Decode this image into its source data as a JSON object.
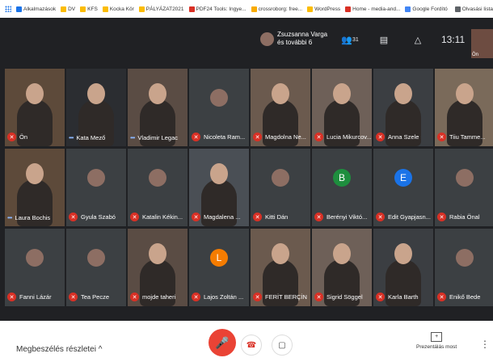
{
  "bookmarks": [
    "Alkalmazások",
    "DV",
    "KFS",
    "Kocka Kör",
    "PÁLYÁZAT2021",
    "PDF24 Tools: Ingye...",
    "crossroborg: free...",
    "WordPress",
    "Home - media-and...",
    "Google Fordító",
    "Olvasási lista"
  ],
  "meeting": {
    "owner_name": "Zsuzsanna Varga",
    "owner_more": "és további 6",
    "participants_count": "31",
    "clock": "13:11",
    "self_label": "Ön"
  },
  "participants": [
    {
      "name": "Ön",
      "muted": true,
      "avatar_letter": "",
      "avatar_color": "",
      "kind": "video"
    },
    {
      "name": "Kata Mező",
      "muted": false,
      "avatar_letter": "",
      "avatar_color": "",
      "kind": "video"
    },
    {
      "name": "Vladimir Legac",
      "muted": false,
      "avatar_letter": "",
      "avatar_color": "",
      "kind": "video"
    },
    {
      "name": "Nicoleta Ram...",
      "muted": true,
      "avatar_letter": "",
      "avatar_color": "",
      "kind": "photo"
    },
    {
      "name": "Magdolna Ne...",
      "muted": true,
      "avatar_letter": "",
      "avatar_color": "",
      "kind": "video"
    },
    {
      "name": "Lucia Mikurcov...",
      "muted": true,
      "avatar_letter": "",
      "avatar_color": "",
      "kind": "video"
    },
    {
      "name": "Anna Szele",
      "muted": true,
      "avatar_letter": "",
      "avatar_color": "",
      "kind": "video"
    },
    {
      "name": "Tiiu Tamme...",
      "muted": true,
      "avatar_letter": "",
      "avatar_color": "",
      "kind": "video"
    },
    {
      "name": "Laura Bochis",
      "muted": false,
      "avatar_letter": "",
      "avatar_color": "",
      "kind": "video"
    },
    {
      "name": "Gyula Szabó",
      "muted": true,
      "avatar_letter": "",
      "avatar_color": "",
      "kind": "photo"
    },
    {
      "name": "Katalin Kékin...",
      "muted": true,
      "avatar_letter": "",
      "avatar_color": "",
      "kind": "photo"
    },
    {
      "name": "Magdalena ...",
      "muted": true,
      "avatar_letter": "",
      "avatar_color": "",
      "kind": "video"
    },
    {
      "name": "Kitti Dán",
      "muted": true,
      "avatar_letter": "",
      "avatar_color": "",
      "kind": "photo"
    },
    {
      "name": "Berényi Viktó...",
      "muted": true,
      "avatar_letter": "B",
      "avatar_color": "#1e8e3e",
      "kind": "letter"
    },
    {
      "name": "Edit Gyapjasn...",
      "muted": true,
      "avatar_letter": "E",
      "avatar_color": "#1a73e8",
      "kind": "letter"
    },
    {
      "name": "Rabia Önal",
      "muted": true,
      "avatar_letter": "",
      "avatar_color": "",
      "kind": "photo"
    },
    {
      "name": "Fanni Lázár",
      "muted": true,
      "avatar_letter": "",
      "avatar_color": "",
      "kind": "photo"
    },
    {
      "name": "Tea Pecze",
      "muted": true,
      "avatar_letter": "",
      "avatar_color": "",
      "kind": "photo"
    },
    {
      "name": "mojde taheri",
      "muted": true,
      "avatar_letter": "",
      "avatar_color": "",
      "kind": "video"
    },
    {
      "name": "Lajos Zoltán ...",
      "muted": true,
      "avatar_letter": "L",
      "avatar_color": "#f57c00",
      "kind": "letter"
    },
    {
      "name": "FERİT BERÇİN",
      "muted": true,
      "avatar_letter": "",
      "avatar_color": "",
      "kind": "video"
    },
    {
      "name": "Sigrid Söggel",
      "muted": true,
      "avatar_letter": "",
      "avatar_color": "",
      "kind": "video"
    },
    {
      "name": "Karla Barth",
      "muted": true,
      "avatar_letter": "",
      "avatar_color": "",
      "kind": "video"
    },
    {
      "name": "Enikő Bede",
      "muted": true,
      "avatar_letter": "",
      "avatar_color": "",
      "kind": "photo"
    }
  ],
  "bottom": {
    "details_label": "Megbeszélés részletei",
    "present_label": "Prezentálás most"
  }
}
